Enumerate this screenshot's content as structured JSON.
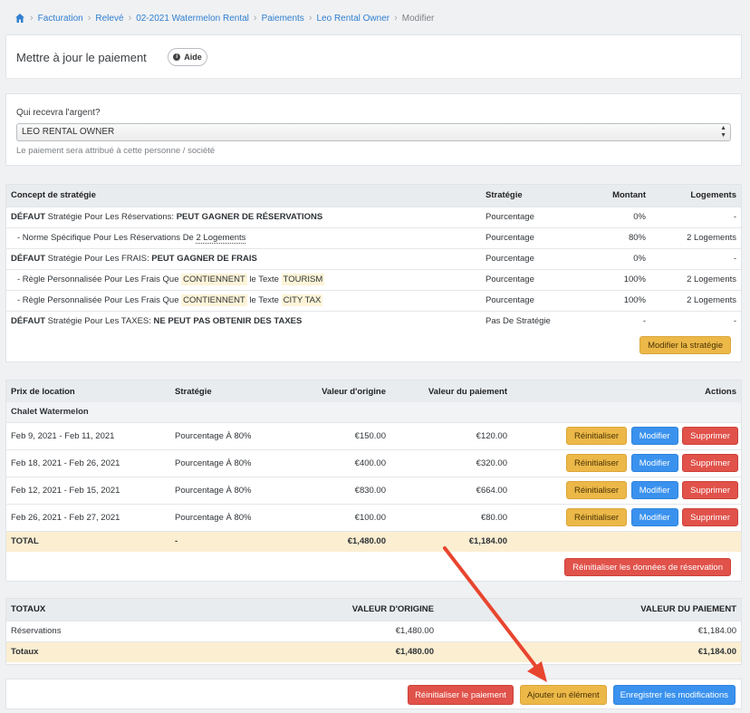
{
  "breadcrumb": {
    "items": [
      "Facturation",
      "Relevé",
      "02-2021 Watermelon Rental",
      "Paiements",
      "Leo Rental Owner"
    ],
    "current": "Modifier"
  },
  "header": {
    "title": "Mettre à jour le paiement",
    "help_label": "Aide"
  },
  "recipient": {
    "label": "Qui recevra l'argent?",
    "selected": "LEO RENTAL OWNER",
    "hint": "Le paiement sera attribué à cette personne / société"
  },
  "strategy": {
    "headers": [
      "Concept de stratégie",
      "Stratégie",
      "Montant",
      "Logements"
    ],
    "rows": [
      {
        "prefix": "DÉFAUT",
        "text": " Stratégie Pour Les Réservations: ",
        "bold": "PEUT GAGNER DE RÉSERVATIONS",
        "strategy": "Pourcentage",
        "amount": "0%",
        "units": "-"
      },
      {
        "text_a": "- Norme Spécifique Pour Les Réservations De ",
        "link": "2 Logements",
        "strategy": "Pourcentage",
        "amount": "80%",
        "units": "2 Logements"
      },
      {
        "prefix": "DÉFAUT",
        "text": " Stratégie Pour Les FRAIS: ",
        "bold": "PEUT GAGNER DE FRAIS",
        "strategy": "Pourcentage",
        "amount": "0%",
        "units": "-"
      },
      {
        "text_a": "- Règle Personnalisée Pour Les Frais Que ",
        "hl1": "CONTIENNENT",
        "text_b": " le Texte ",
        "hl2": "TOURISM",
        "strategy": "Pourcentage",
        "amount": "100%",
        "units": "2 Logements"
      },
      {
        "text_a": "- Règle Personnalisée Pour Les Frais Que ",
        "hl1": "CONTIENNENT",
        "text_b": " le Texte ",
        "hl2": "CITY TAX",
        "strategy": "Pourcentage",
        "amount": "100%",
        "units": "2 Logements"
      },
      {
        "prefix": "DÉFAUT",
        "text": " Stratégie Pour Les TAXES: ",
        "bold": "NE PEUT PAS OBTENIR DES TAXES",
        "strategy": "Pas De Stratégie",
        "amount": "-",
        "units": "-"
      }
    ],
    "button": "Modifier la stratégie"
  },
  "rent": {
    "headers": [
      "Prix de location",
      "Stratégie",
      "Valeur d'origine",
      "Valeur du paiement",
      "Actions"
    ],
    "group": "Chalet Watermelon",
    "rows": [
      {
        "dates": "Feb 9, 2021 - Feb 11, 2021",
        "strategy": "Pourcentage À 80%",
        "original": "€150.00",
        "payment": "€120.00"
      },
      {
        "dates": "Feb 18, 2021 - Feb 26, 2021",
        "strategy": "Pourcentage À 80%",
        "original": "€400.00",
        "payment": "€320.00"
      },
      {
        "dates": "Feb 12, 2021 - Feb 15, 2021",
        "strategy": "Pourcentage À 80%",
        "original": "€830.00",
        "payment": "€664.00"
      },
      {
        "dates": "Feb 26, 2021 - Feb 27, 2021",
        "strategy": "Pourcentage À 80%",
        "original": "€100.00",
        "payment": "€80.00"
      }
    ],
    "actions": {
      "reset": "Réinitialiser",
      "edit": "Modifier",
      "delete": "Supprimer"
    },
    "total": {
      "label": "TOTAL",
      "strategy": "-",
      "original": "€1,480.00",
      "payment": "€1,184.00"
    },
    "reset_button": "Réinitialiser les données de réservation"
  },
  "totals": {
    "headers": [
      "TOTAUX",
      "VALEUR D'ORIGINE",
      "VALEUR DU PAIEMENT"
    ],
    "rows": [
      {
        "label": "Réservations",
        "original": "€1,480.00",
        "payment": "€1,184.00"
      },
      {
        "label": "Totaux",
        "original": "€1,480.00",
        "payment": "€1,184.00"
      }
    ]
  },
  "footer": {
    "reset_payment": "Réinitialiser le paiement",
    "add_item": "Ajouter un élément",
    "save": "Enregistrer les modifications"
  },
  "colors": {
    "link": "#2f7fd0",
    "warning": "#ecb848",
    "info": "#3a92ee",
    "danger": "#e0524a",
    "annotation_arrow": "#e8452f"
  }
}
